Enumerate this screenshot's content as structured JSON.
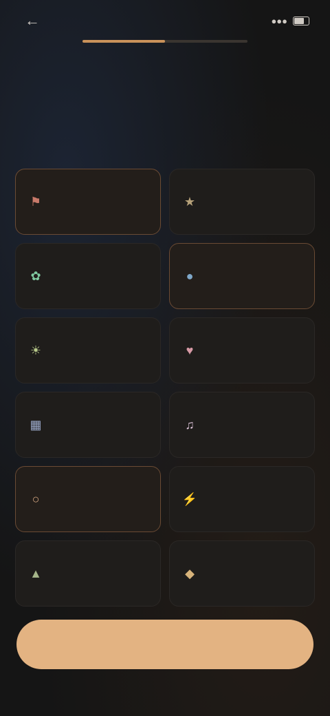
{
  "status": {
    "time": "",
    "battery_label": ""
  },
  "progress": {
    "fraction": 0.5,
    "color": "#c9925a"
  },
  "header": {
    "title": "",
    "subtitle": ""
  },
  "options": [
    {
      "label": "",
      "icon": "flag-icon",
      "icon_color": "#c97a6a",
      "selected": true
    },
    {
      "label": "",
      "icon": "star-icon",
      "icon_color": "#b7a27a",
      "selected": false
    },
    {
      "label": "",
      "icon": "leaf-icon",
      "icon_color": "#7fc9a0",
      "selected": false
    },
    {
      "label": "",
      "icon": "drop-icon",
      "icon_color": "#7fa8c9",
      "selected": true
    },
    {
      "label": "",
      "icon": "sun-icon",
      "icon_color": "#b8c98a",
      "selected": false
    },
    {
      "label": "",
      "icon": "heart-icon",
      "icon_color": "#d79aa6",
      "selected": false
    },
    {
      "label": "",
      "icon": "book-icon",
      "icon_color": "#9aa8c9",
      "selected": false
    },
    {
      "label": "",
      "icon": "music-icon",
      "icon_color": "#d9c0d4",
      "selected": false
    },
    {
      "label": "",
      "icon": "globe-icon",
      "icon_color": "#d6a882",
      "selected": true
    },
    {
      "label": "",
      "icon": "bolt-icon",
      "icon_color": "#b6817a",
      "selected": false
    },
    {
      "label": "",
      "icon": "chart-icon",
      "icon_color": "#a5b58a",
      "selected": false
    },
    {
      "label": "",
      "icon": "bulb-icon",
      "icon_color": "#d7b37a",
      "selected": false
    }
  ],
  "cta": {
    "label": "",
    "background": "#e3b382"
  }
}
